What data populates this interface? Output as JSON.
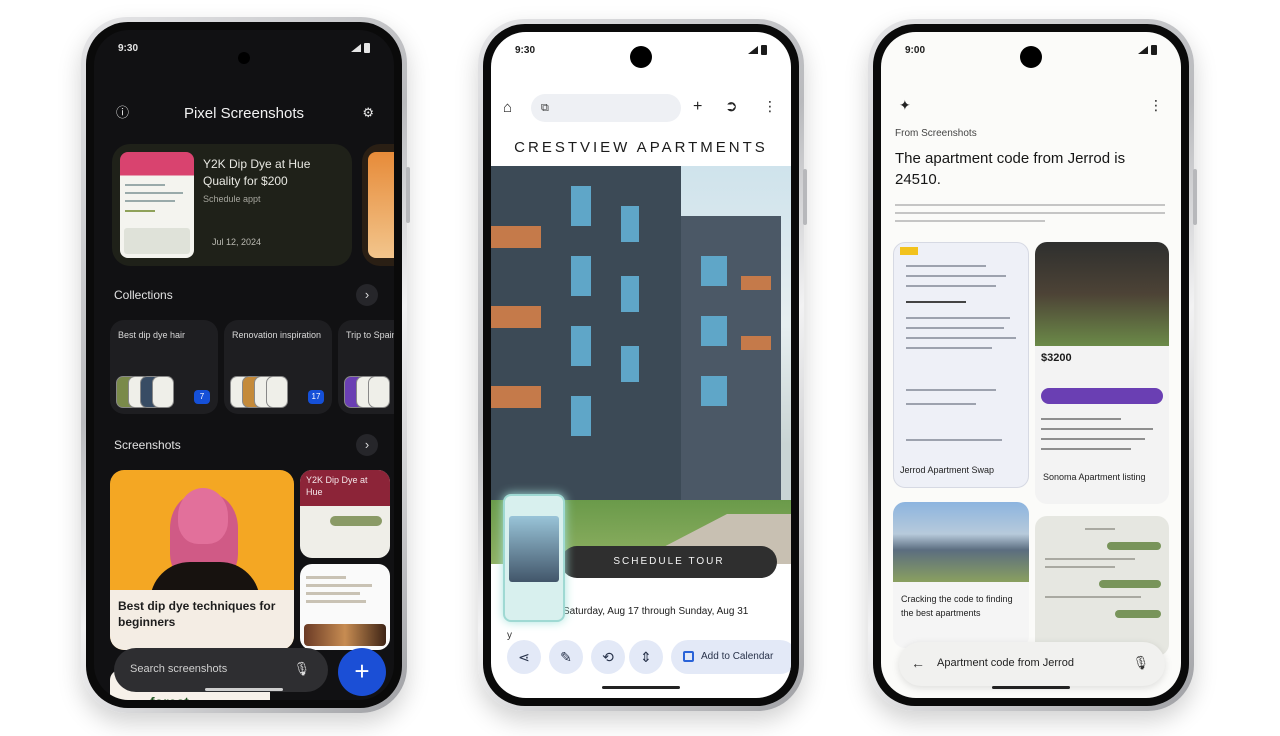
{
  "phone1": {
    "status": {
      "time": "9:30",
      "icons": "5G ▲▮"
    },
    "header": {
      "title": "Pixel Screenshots",
      "left_icon": "info-icon",
      "right_icon": "settings-icon"
    },
    "featured": {
      "title": "Y2K Dip Dye at Hue Quality for $200",
      "subtitle": "Schedule appt",
      "date": "Jul 12, 2024"
    },
    "collections": {
      "title": "Collections",
      "items": [
        {
          "name": "Best dip dye hair",
          "count": "7"
        },
        {
          "name": "Renovation inspiration",
          "count": "17"
        },
        {
          "name": "Trip to Spain",
          "count": ""
        }
      ]
    },
    "screenshots": {
      "title": "Screenshots",
      "main_caption": "Best dip dye techniques for beginners",
      "small_caption": "Y2K Dip Dye at Hue"
    },
    "search": {
      "placeholder": "Search screenshots"
    },
    "fab": "+",
    "bottom_label": "forest"
  },
  "phone2": {
    "status": {
      "time": "9:30",
      "icons": "5G ▲▮"
    },
    "site_title": "CRESTVIEW APARTMENTS",
    "schedule_button": "SCHEDULE TOUR",
    "date_line": "Saturday, Aug 17 through Sunday, Aug 31",
    "corner_text": "y",
    "actions": {
      "calendar": "Add to Calendar"
    }
  },
  "phone3": {
    "status": {
      "time": "9:00",
      "icons": "5G ▲▮"
    },
    "label": "From Screenshots",
    "answer": "The apartment code from Jerrod is 24510.",
    "cards": {
      "listing_caption": "Jerrod Apartment Swap",
      "price": "$3200",
      "property_caption": "Sonoma Apartment listing",
      "search_caption": "Cracking the code to finding the best apartments"
    },
    "search": {
      "query": "Apartment code from Jerrod"
    }
  }
}
